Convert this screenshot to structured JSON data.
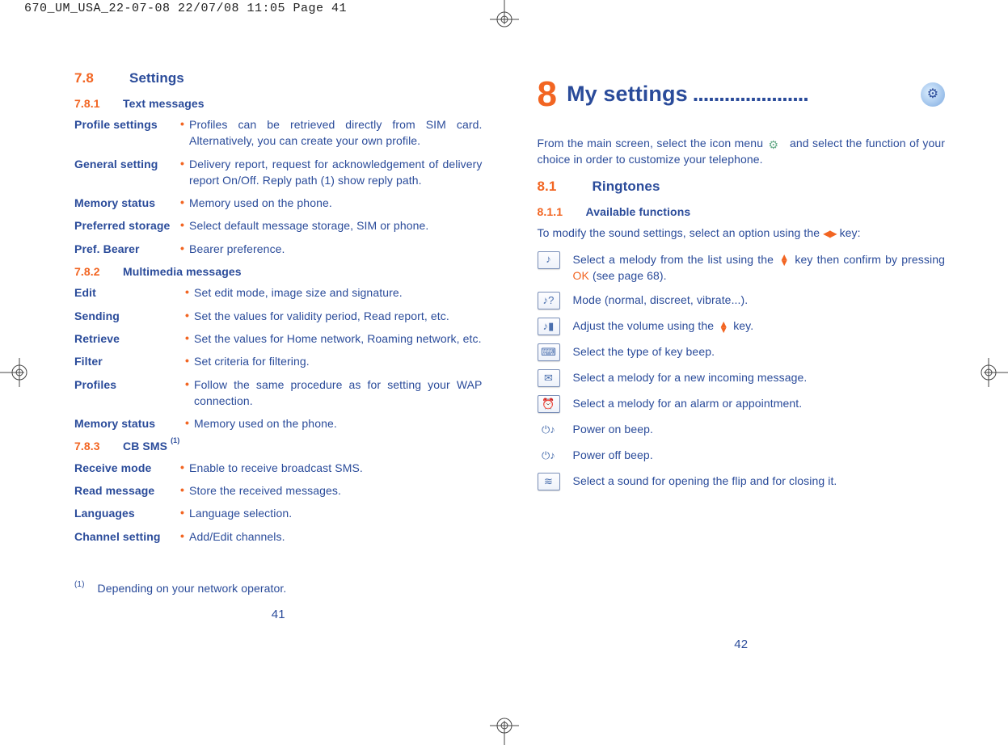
{
  "header": {
    "print_line": "670_UM_USA_22-07-08  22/07/08  11:05  Page 41"
  },
  "left": {
    "sec": {
      "num": "7.8",
      "title": "Settings"
    },
    "sub1": {
      "num": "7.8.1",
      "title": "Text messages"
    },
    "tm": [
      {
        "t": "Profile settings",
        "d": "Profiles can be retrieved directly from SIM card. Alternatively, you can create your own profile."
      },
      {
        "t": "General setting",
        "d": "Delivery report, request for acknowledgement of delivery report On/Off. Reply path (1) show reply path."
      },
      {
        "t": "Memory status",
        "d": "Memory used on the phone."
      },
      {
        "t": "Preferred storage",
        "d": "Select default message storage, SIM or phone."
      },
      {
        "t": "Pref. Bearer",
        "d": "Bearer preference."
      }
    ],
    "sub2": {
      "num": "7.8.2",
      "title": "Multimedia messages"
    },
    "mm": [
      {
        "t": "Edit",
        "d": "Set edit mode, image size and signature."
      },
      {
        "t": "Sending",
        "d": "Set the values for validity period, Read report, etc."
      },
      {
        "t": "Retrieve",
        "d": "Set the values for Home network, Roaming network, etc."
      },
      {
        "t": "Filter",
        "d": "Set criteria for filtering."
      },
      {
        "t": "Profiles",
        "d": "Follow the same procedure as for setting your WAP connection."
      },
      {
        "t": "Memory status",
        "d": "Memory used on the phone."
      }
    ],
    "sub3": {
      "num": "7.8.3",
      "title": "CB SMS",
      "sup": "(1)"
    },
    "cb": [
      {
        "t": "Receive mode",
        "d": "Enable to receive broadcast SMS."
      },
      {
        "t": "Read message",
        "d": "Store the received messages."
      },
      {
        "t": "Languages",
        "d": "Language selection."
      },
      {
        "t": "Channel setting",
        "d": "Add/Edit channels."
      }
    ],
    "footnote": {
      "mark": "(1)",
      "text": "Depending on your network operator."
    },
    "page": "41"
  },
  "right": {
    "chapter_num": "8",
    "chapter_title": "My settings",
    "chapter_dots": "......................",
    "intro_1": "From the main screen, select the icon menu",
    "intro_2": "and select the function of your choice in order to customize your telephone.",
    "sec": {
      "num": "8.1",
      "title": "Ringtones"
    },
    "sub": {
      "num": "8.1.1",
      "title": "Available functions"
    },
    "lead_a": "To modify the sound settings, select an option using the",
    "lead_b": "key:",
    "items": [
      {
        "icon": "melody-icon",
        "glyph": "♪",
        "text_a": "Select a melody from the list using the",
        "text_b": "key then confirm by pressing",
        "text_c": "(see page 68).",
        "ok": "OK",
        "has_updown": true
      },
      {
        "icon": "mode-icon",
        "glyph": "♪?",
        "text": "Mode (normal, discreet, vibrate...)."
      },
      {
        "icon": "volume-icon",
        "glyph": "♪▮",
        "text_a": "Adjust the volume using the",
        "text_b": "key.",
        "has_updown": true
      },
      {
        "icon": "keybeep-icon",
        "glyph": "⌨",
        "text": "Select the type of key beep."
      },
      {
        "icon": "envelope-icon",
        "glyph": "✉",
        "text": "Select a melody for a new incoming message."
      },
      {
        "icon": "alarm-icon",
        "glyph": "⏰",
        "text": "Select a melody for an alarm or appointment."
      },
      {
        "icon": "power-on-icon",
        "glyph": "⏻♪",
        "border": false,
        "text": "Power on beep."
      },
      {
        "icon": "power-off-icon",
        "glyph": "⏻♪",
        "border": false,
        "text": "Power off beep."
      },
      {
        "icon": "flip-icon",
        "glyph": "≋",
        "text": "Select a sound for opening the flip and for closing it."
      }
    ],
    "page": "42"
  }
}
